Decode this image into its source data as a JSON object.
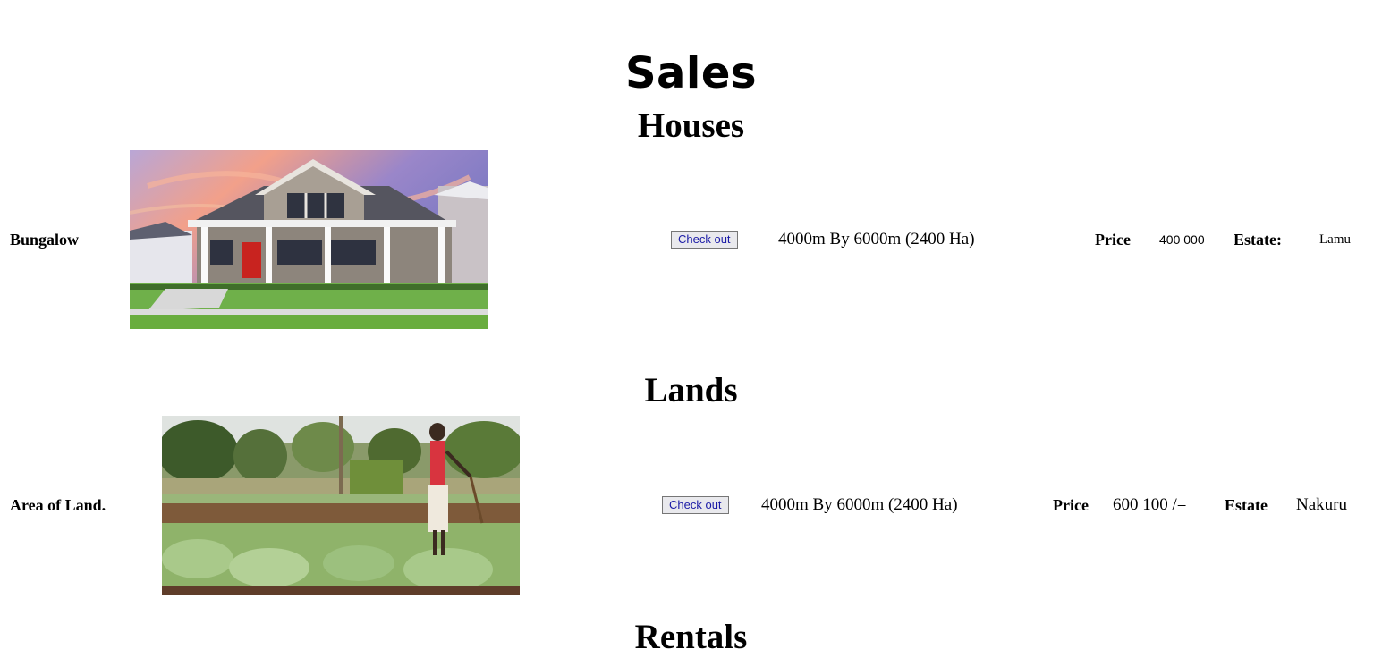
{
  "page_title": "Sales",
  "sections": {
    "houses": {
      "heading": "Houses",
      "item": {
        "name": "Bungalow",
        "image_alt": "Bungalow house photo",
        "button_label": "Check out",
        "dimensions": "4000m By 6000m (2400 Ha)",
        "price_label": "Price",
        "price_value": "400 000",
        "estate_label": "Estate:",
        "estate_value": "Lamu"
      }
    },
    "lands": {
      "heading": "Lands",
      "item": {
        "name": "Area of Land.",
        "image_alt": "Farm land photo",
        "button_label": "Check out",
        "dimensions": "4000m By 6000m (2400 Ha)",
        "price_label": "Price",
        "price_value": "600 100 /=",
        "estate_label": "Estate",
        "estate_value": "Nakuru"
      }
    },
    "rentals": {
      "heading": "Rentals"
    }
  },
  "colors": {
    "button_text": "#1a1aa6",
    "button_bg": "#e9e9ed",
    "button_border": "#767676"
  }
}
